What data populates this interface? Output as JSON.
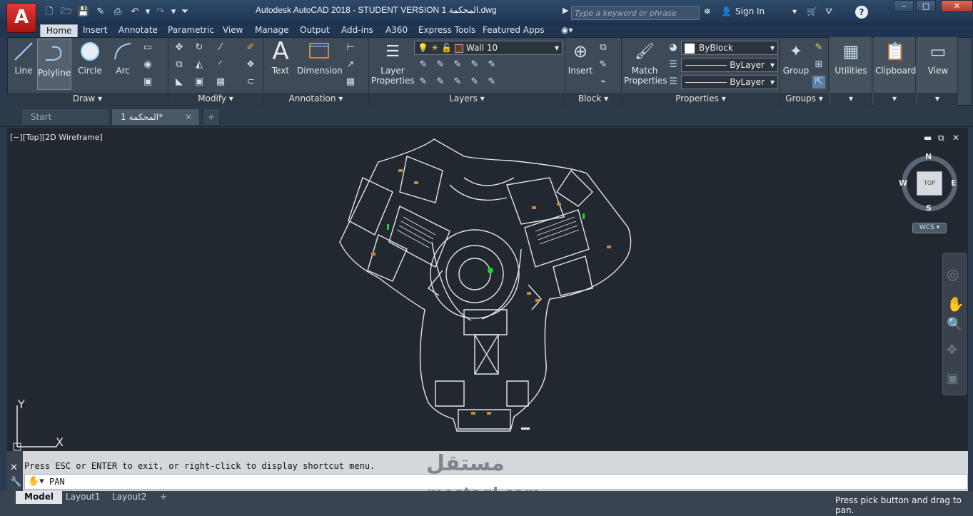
{
  "app": {
    "logo": "A",
    "title": "Autodesk AutoCAD 2018 - STUDENT VERSION   المحكمة 1.dwg"
  },
  "search": {
    "placeholder": "Type a keyword or phrase"
  },
  "account": {
    "sign_in": "Sign In"
  },
  "window_controls": {
    "minimize": "–",
    "maximize": "□",
    "close": "✕"
  },
  "ribbon_tabs": [
    "Home",
    "Insert",
    "Annotate",
    "Parametric",
    "View",
    "Manage",
    "Output",
    "Add-ins",
    "A360",
    "Express Tools",
    "Featured Apps"
  ],
  "draw_panel": {
    "title": "Draw",
    "line": "Line",
    "polyline": "Polyline",
    "circle": "Circle",
    "arc": "Arc"
  },
  "modify_panel": {
    "title": "Modify"
  },
  "annotation_panel": {
    "title": "Annotation",
    "text": "Text",
    "dimension": "Dimension"
  },
  "layers_panel": {
    "title": "Layers",
    "layer_properties_1": "Layer",
    "layer_properties_2": "Properties",
    "current_layer": "Wall 10"
  },
  "block_panel": {
    "title": "Block",
    "insert": "Insert"
  },
  "properties_panel": {
    "title": "Properties",
    "match_1": "Match",
    "match_2": "Properties",
    "color": "ByBlock",
    "linetype": "ByLayer",
    "lineweight": "ByLayer"
  },
  "groups_panel": {
    "title": "Groups",
    "group": "Group"
  },
  "utilities": {
    "label": "Utilities"
  },
  "clipboard": {
    "label": "Clipboard"
  },
  "view": {
    "label": "View"
  },
  "doc_tabs": {
    "start": "Start",
    "file": "المحكمة 1*",
    "add": "+"
  },
  "viewport": {
    "label": "[−][Top][2D Wireframe]"
  },
  "viewcube": {
    "n": "N",
    "s": "S",
    "e": "E",
    "w": "W",
    "face": "TOP",
    "wcs": "WCS"
  },
  "ucs": {
    "x": "X",
    "y": "Y"
  },
  "command": {
    "history": "Press ESC or ENTER to exit, or right-click to display shortcut menu.",
    "current": "PAN"
  },
  "layout_tabs": {
    "model": "Model",
    "layout1": "Layout1",
    "layout2": "Layout2",
    "add": "+"
  },
  "status": {
    "message": "Press pick button and drag to pan."
  },
  "watermark": {
    "arabic": "مستقل",
    "latin": "mostaql.com"
  },
  "colors": {
    "title_bg": "#1f3552",
    "ribbon_bg": "#3e4a58",
    "viewport_bg": "#212830",
    "logo_red": "#d42b2b"
  }
}
